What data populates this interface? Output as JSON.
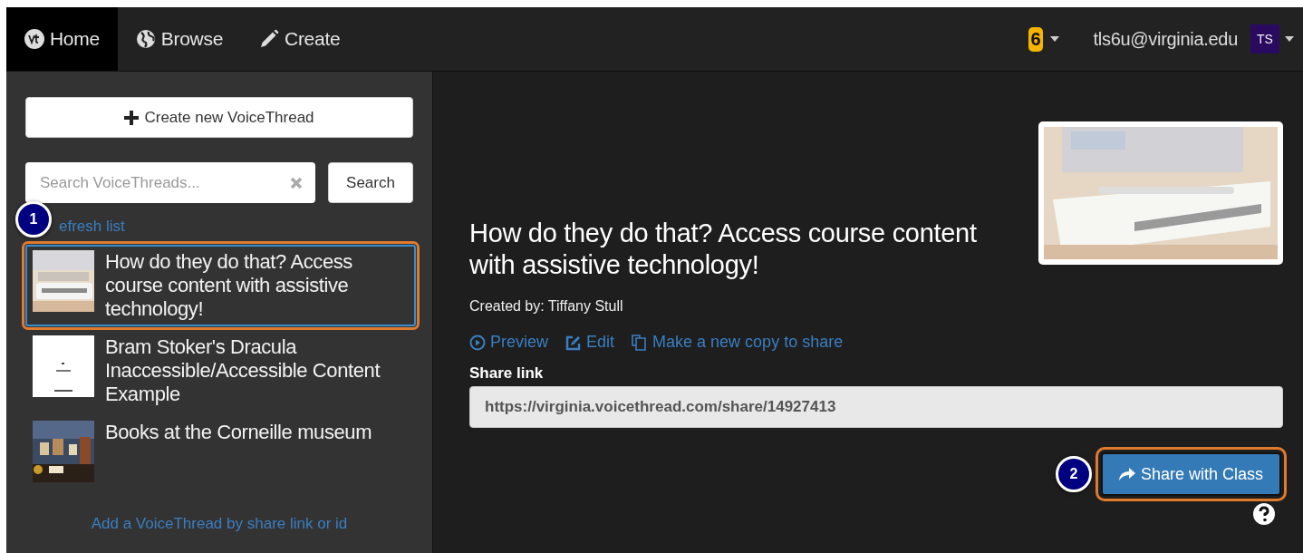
{
  "nav": {
    "tabs": [
      {
        "label": "Home",
        "selected": true
      },
      {
        "label": "Browse",
        "selected": false
      },
      {
        "label": "Create",
        "selected": false
      }
    ],
    "notifications": "6",
    "email": "tls6u@virginia.edu",
    "avatar": "TS"
  },
  "sidebar": {
    "create_button": "Create new VoiceThread",
    "search": {
      "placeholder": "Search VoiceThreads...",
      "button": "Search"
    },
    "refresh_link": "efresh list",
    "refresh_callout": "1",
    "items": [
      {
        "title": "How do they do that? Access course content with assistive technology!",
        "selected": true,
        "highlighted": true
      },
      {
        "title": "Bram Stoker's Dracula Inaccessible/Accessible Content Example",
        "selected": false,
        "highlighted": false
      },
      {
        "title": "Books at the Corneille museum",
        "selected": false,
        "highlighted": false
      }
    ],
    "add_link": "Add a VoiceThread by share link or id"
  },
  "detail": {
    "title": "How do they do that? Access course content with assistive technology!",
    "created_by": "Created by: Tiffany Stull",
    "actions": [
      {
        "label": "Preview"
      },
      {
        "label": "Edit"
      },
      {
        "label": "Make a new copy to share"
      }
    ],
    "share_label": "Share link",
    "share_url": "https://virginia.voicethread.com/share/14927413",
    "share_button": "Share with Class",
    "share_callout": "2",
    "share_highlighted": true
  }
}
